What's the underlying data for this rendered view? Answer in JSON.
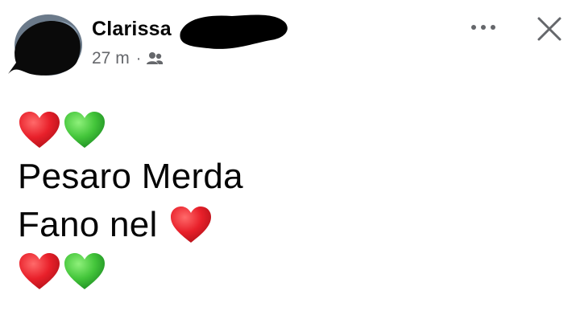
{
  "post": {
    "author_name": "Clarissa",
    "timestamp": "27 m",
    "separator": "·",
    "audience_icon": "friends-icon",
    "more_icon": "more-options-icon",
    "close_icon": "close-icon",
    "lines": [
      {
        "type": "emoji",
        "hearts": [
          "red",
          "green"
        ]
      },
      {
        "type": "text",
        "text": "Pesaro Merda"
      },
      {
        "type": "text",
        "text": "Fano nel",
        "trailing_heart": "red"
      },
      {
        "type": "emoji",
        "hearts": [
          "red",
          "green"
        ]
      }
    ]
  },
  "colors": {
    "red_heart": "#e8202a",
    "green_heart": "#43c53a",
    "secondary_text": "#65676b",
    "primary_text": "#050505"
  }
}
